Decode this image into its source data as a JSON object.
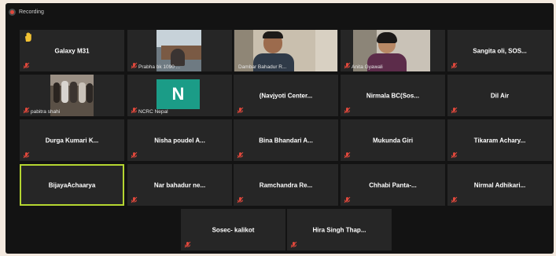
{
  "window": {
    "recording_label": "Recording"
  },
  "tiles": [
    {
      "name": "Galaxy M31",
      "muted": true,
      "raised_hand": true
    },
    {
      "name": "Prabha bk 1090 ...",
      "muted": true,
      "video": true
    },
    {
      "name": "Dambar Bahadur R...",
      "muted": false,
      "video": true
    },
    {
      "name": "Anita Gyawali",
      "muted": true,
      "video": true
    },
    {
      "name": "Sangita oli, SOS...",
      "muted": true
    },
    {
      "name": "pabitra shahi",
      "muted": true,
      "video": true
    },
    {
      "name": "NCRC Nepal",
      "muted": true,
      "avatar_initial": "N"
    },
    {
      "name": "(Navjyoti Center...",
      "muted": true
    },
    {
      "name": "Nirmala BC(Sos...",
      "muted": true
    },
    {
      "name": "Dil Air",
      "muted": true
    },
    {
      "name": "Durga Kumari K...",
      "muted": true
    },
    {
      "name": "Nisha poudel A...",
      "muted": true
    },
    {
      "name": "Bina Bhandari A...",
      "muted": true
    },
    {
      "name": "Mukunda Giri",
      "muted": true
    },
    {
      "name": "Tikaram Achary...",
      "muted": true
    },
    {
      "name": "BijayaAchaarya",
      "muted": true,
      "active_speaker": true
    },
    {
      "name": "Nar bahadur ne...",
      "muted": true
    },
    {
      "name": "Ramchandra Re...",
      "muted": true
    },
    {
      "name": "Chhabi Panta-...",
      "muted": true
    },
    {
      "name": "Nirmal Adhikari...",
      "muted": true
    },
    {
      "name": "Sosec- kalikot",
      "muted": true
    },
    {
      "name": "Hira Singh Thap...",
      "muted": true
    }
  ],
  "colors": {
    "background": "#131313",
    "tile": "#262626",
    "active_border": "#b5d631",
    "mute_icon": "#e0483c",
    "avatar": "#1b9c87"
  }
}
